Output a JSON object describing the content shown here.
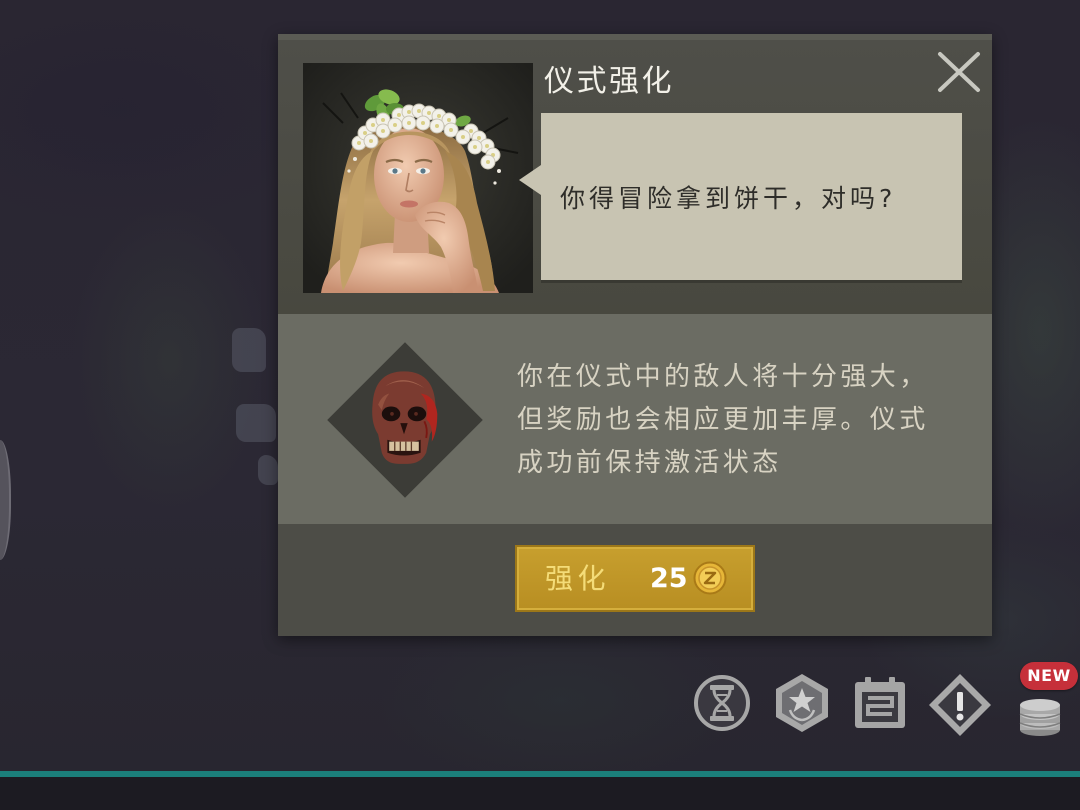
{
  "dialog": {
    "title": "仪式强化",
    "speech": "你得冒险拿到饼干，对吗?",
    "close_icon": "close-icon",
    "modifier": {
      "icon": "zombie-head-icon",
      "description_lines": [
        "你在仪式中的敌人将十分强大，",
        "但奖励也会相应更加丰厚。仪式",
        "成功前保持激活状态"
      ]
    },
    "action_button": {
      "label": "强化",
      "cost": "25",
      "currency_icon": "coin-icon"
    }
  },
  "hud": {
    "icons": [
      {
        "icon": "dna-icon"
      },
      {
        "icon": "hexagon-star-badge-icon"
      },
      {
        "icon": "calendar-icon"
      },
      {
        "icon": "diamond-alert-icon"
      },
      {
        "icon": "coin-stack-icon",
        "badge": "NEW"
      }
    ]
  },
  "theme": {
    "panel_dark": "#4d4d47",
    "panel_mid": "#6b6c63",
    "bubble": "#c8c4b2",
    "button_gold": "#c19a2d",
    "button_text": "#f4dc78",
    "teal_bar": "#1b7f7b",
    "badge_red": "#c6303a"
  }
}
